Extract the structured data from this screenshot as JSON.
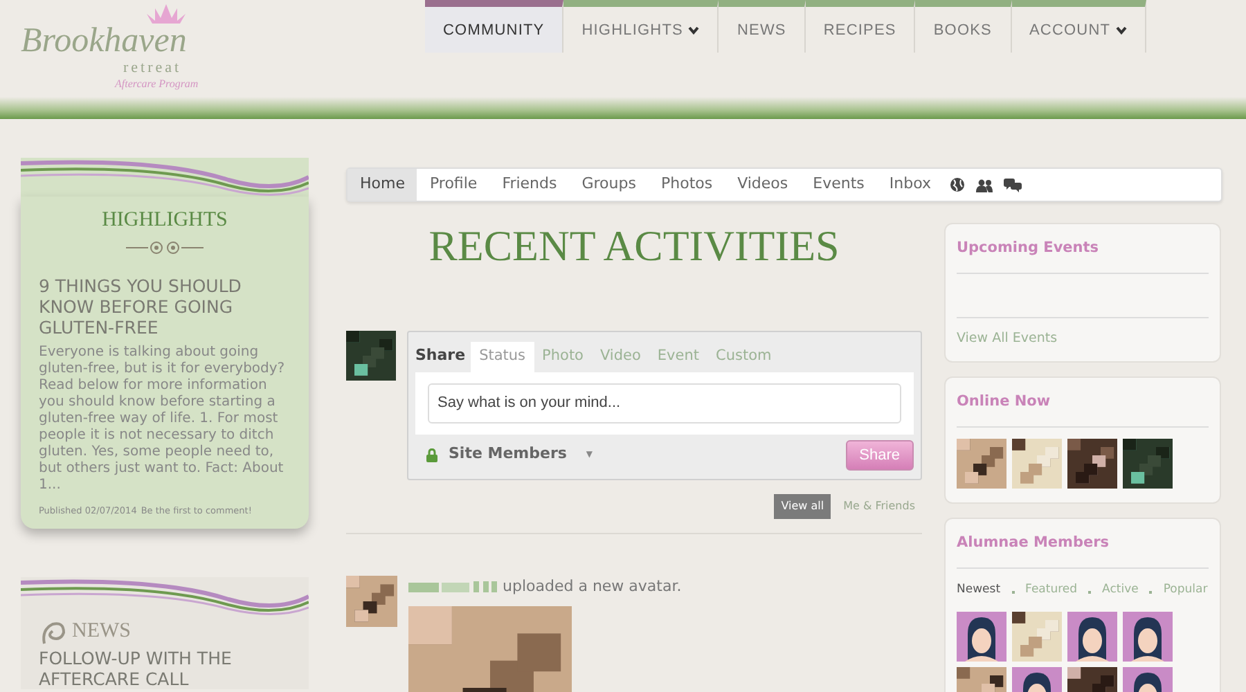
{
  "logo": {
    "name": "Brookhaven",
    "sub": "retreat",
    "program": "Aftercare Program"
  },
  "main_nav": [
    {
      "label": "COMMUNITY",
      "selected": true,
      "dropdown": false
    },
    {
      "label": "HIGHLIGHTS",
      "selected": false,
      "dropdown": true
    },
    {
      "label": "NEWS",
      "selected": false,
      "dropdown": false
    },
    {
      "label": "RECIPES",
      "selected": false,
      "dropdown": false
    },
    {
      "label": "BOOKS",
      "selected": false,
      "dropdown": false
    },
    {
      "label": "ACCOUNT",
      "selected": false,
      "dropdown": true
    }
  ],
  "highlights": {
    "title": "HIGHLIGHTS",
    "article_title": "9 THINGS YOU SHOULD KNOW BEFORE GOING GLUTEN-FREE",
    "excerpt": "Everyone is talking about going gluten-free, but is it for everybody? Read below for more information you should know before starting a gluten-free way of life. 1. For most people it is not necessary to ditch gluten. Yes, some people need to, but others just want to. Fact: About 1...",
    "published": "Published 02/07/2014",
    "comment_link": "Be the first to comment!"
  },
  "news": {
    "title": "NEWS",
    "article_title": "FOLLOW-UP WITH THE AFTERCARE CALL"
  },
  "community_tabs": [
    {
      "label": "Home",
      "selected": true
    },
    {
      "label": "Profile",
      "selected": false
    },
    {
      "label": "Friends",
      "selected": false
    },
    {
      "label": "Groups",
      "selected": false
    },
    {
      "label": "Photos",
      "selected": false
    },
    {
      "label": "Videos",
      "selected": false
    },
    {
      "label": "Events",
      "selected": false
    },
    {
      "label": "Inbox",
      "selected": false
    }
  ],
  "page_title": "RECENT ACTIVITIES",
  "composer": {
    "label": "Share",
    "tabs": [
      {
        "label": "Status",
        "selected": true
      },
      {
        "label": "Photo",
        "selected": false
      },
      {
        "label": "Video",
        "selected": false
      },
      {
        "label": "Event",
        "selected": false
      },
      {
        "label": "Custom",
        "selected": false
      }
    ],
    "placeholder": "Say what is on your mind...",
    "privacy": "Site Members",
    "privacy_caret": "▼",
    "button": "Share"
  },
  "filters": [
    {
      "label": "View all",
      "selected": true
    },
    {
      "label": "Me & Friends",
      "selected": false
    }
  ],
  "activity": {
    "text": "uploaded a new avatar."
  },
  "upcoming_events": {
    "title": "Upcoming Events",
    "link": "View All Events"
  },
  "online_now": {
    "title": "Online Now",
    "avatars": [
      {
        "kind": "picture"
      },
      {
        "kind": "picture"
      },
      {
        "kind": "picture"
      },
      {
        "kind": "picture"
      }
    ]
  },
  "alumnae": {
    "title": "Alumnae Members",
    "filters": [
      {
        "label": "Newest",
        "selected": true
      },
      {
        "label": "Featured",
        "selected": false
      },
      {
        "label": "Active",
        "selected": false
      },
      {
        "label": "Popular",
        "selected": false
      }
    ],
    "members": [
      {
        "kind": "silhouette"
      },
      {
        "kind": "picture"
      },
      {
        "kind": "silhouette"
      },
      {
        "kind": "silhouette"
      },
      {
        "kind": "picture"
      },
      {
        "kind": "silhouette"
      },
      {
        "kind": "picture"
      },
      {
        "kind": "silhouette"
      }
    ]
  }
}
